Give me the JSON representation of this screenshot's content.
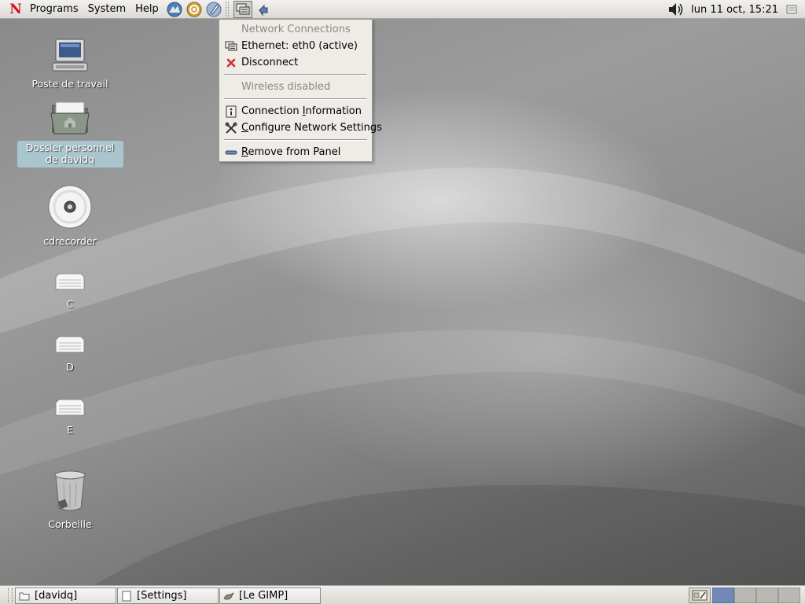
{
  "top_panel": {
    "logo_letter": "N",
    "menus": [
      {
        "label": "Programs"
      },
      {
        "label": "System"
      },
      {
        "label": "Help"
      }
    ],
    "launchers": [
      "web-browser-icon",
      "mail-client-icon",
      "text-editor-icon"
    ],
    "applets": [
      "network-monitor-icon",
      "network-settings-icon"
    ],
    "clock": "lun 11 oct, 15:21",
    "volume_icon": "speaker-volume-icon",
    "notification_icon": "notification-area-icon"
  },
  "desktop_icons": [
    {
      "label": "Poste de travail",
      "icon": "computer-icon"
    },
    {
      "label": "Dossier personnel de davidq",
      "icon": "home-folder-icon",
      "selected": true
    },
    {
      "label": "cdrecorder",
      "icon": "cd-disc-icon"
    },
    {
      "label": "C",
      "icon": "drive-icon"
    },
    {
      "label": "D",
      "icon": "drive-icon"
    },
    {
      "label": "E",
      "icon": "drive-icon"
    },
    {
      "label": "Corbeille",
      "icon": "trash-icon"
    }
  ],
  "network_menu": {
    "header": "Network Connections",
    "ethernet": "Ethernet: eth0 (active)",
    "disconnect": "Disconnect",
    "wireless": "Wireless disabled",
    "connection_info_pre": "Connection ",
    "connection_info_mnemonic": "I",
    "connection_info_post": "nformation",
    "configure_mnemonic": "C",
    "configure_post": "onfigure Network Settings",
    "remove_mnemonic": "R",
    "remove_post": "emove from Panel"
  },
  "taskbar": {
    "tasks": [
      {
        "label": "[davidq]",
        "icon": "folder-icon"
      },
      {
        "label": "[Settings]",
        "icon": "document-icon"
      },
      {
        "label": "[Le GIMP]",
        "icon": "gimp-icon"
      }
    ],
    "workspaces": 4,
    "active_workspace": 1
  },
  "colors": {
    "menu_bg": "#efebe7",
    "selection": "#a9c6cf",
    "active_workspace": "#7189b4",
    "logo_red": "#d4111a"
  }
}
